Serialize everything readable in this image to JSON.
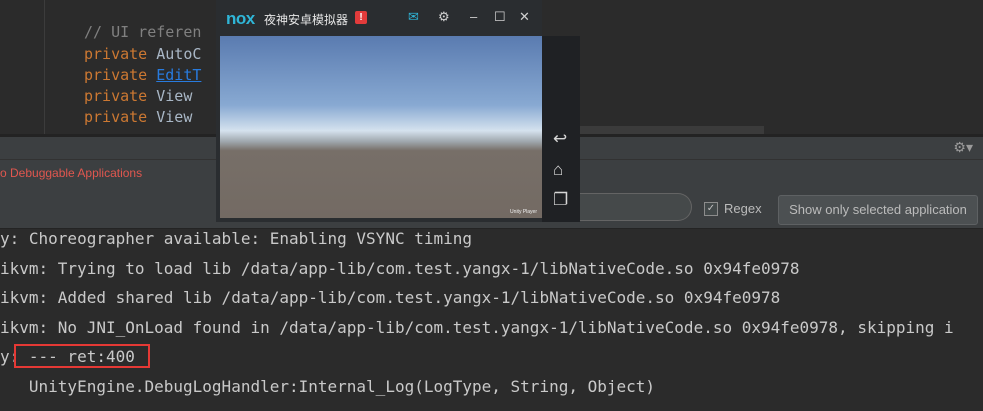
{
  "editor": {
    "comment": "// UI referen",
    "lines": [
      {
        "kw": "private",
        "rest": "AutoC",
        "link": false
      },
      {
        "kw": "private",
        "rest": "EditT",
        "link": true
      },
      {
        "kw": "private",
        "rest": "View ",
        "link": false
      },
      {
        "kw": "private",
        "rest": "View ",
        "link": false
      }
    ]
  },
  "filter": {
    "debuggable_label": "o Debuggable Applications",
    "regex_label": "Regex",
    "regex_checked": "✓",
    "show_only_selected_label": "Show only selected application"
  },
  "logcat": {
    "lines": [
      "y: Choreographer available: Enabling VSYNC timing",
      "ikvm: Trying to load lib /data/app-lib/com.test.yangx-1/libNativeCode.so 0x94fe0978",
      "ikvm: Added shared lib /data/app-lib/com.test.yangx-1/libNativeCode.so 0x94fe0978",
      "ikvm: No JNI_OnLoad found in /data/app-lib/com.test.yangx-1/libNativeCode.so 0x94fe0978, skipping i",
      "y: --- ret:400",
      "   UnityEngine.DebugLogHandler:Internal_Log(LogType, String, Object)"
    ]
  },
  "emulator": {
    "logo": "nox",
    "title": "夜神安卓模拟器",
    "alert": "!",
    "screen_text": "Unity Player",
    "controls": {
      "mail_icon": "✉",
      "settings_icon": "⚙",
      "minimize_icon": "–",
      "maximize_icon": "☐",
      "close_icon": "✕"
    },
    "nav": {
      "back_icon": "↩",
      "home_icon": "⌂",
      "recents_icon": "❐"
    }
  },
  "toolbar": {
    "gear_icon": "⚙▾"
  },
  "colors": {
    "keyword": "#cc7832",
    "link": "#287bde",
    "debuggable": "#e0574f",
    "highlight": "#e53935",
    "nox_blue": "#2fb6d8"
  }
}
